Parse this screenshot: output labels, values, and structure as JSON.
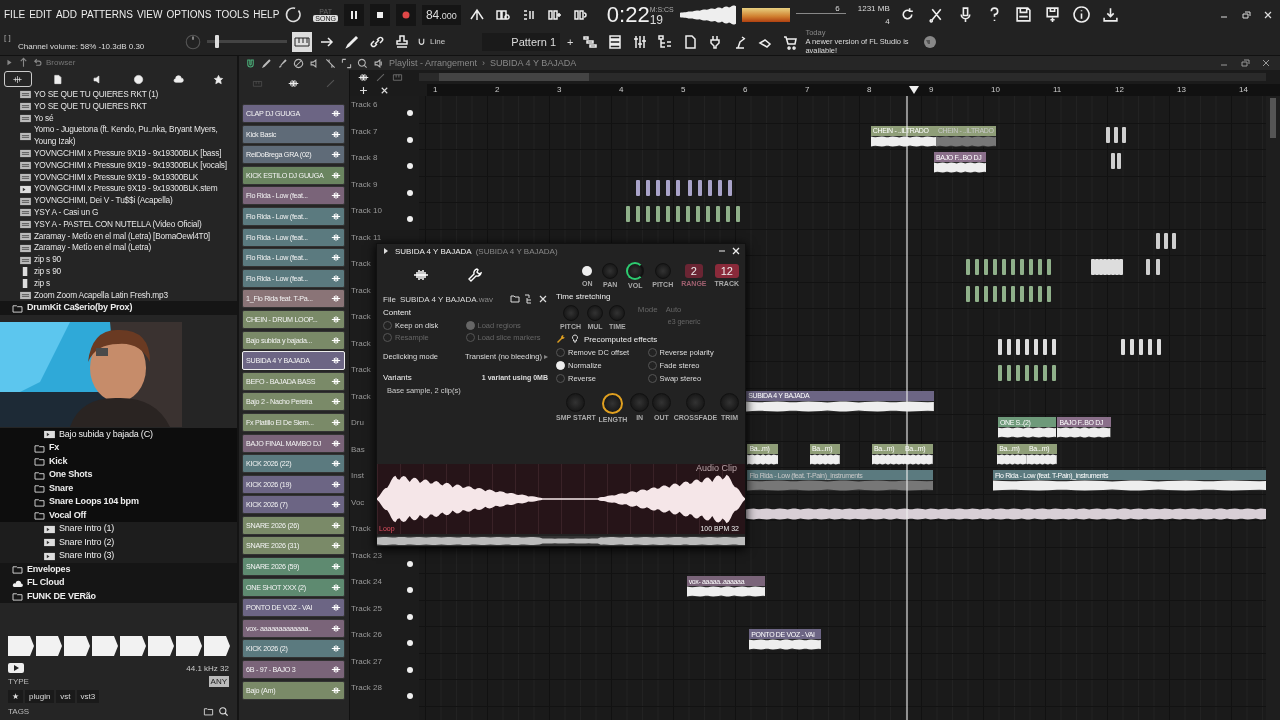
{
  "menu": [
    "FILE",
    "EDIT",
    "ADD",
    "PATTERNS",
    "VIEW",
    "OPTIONS",
    "TOOLS",
    "HELP"
  ],
  "transport": {
    "modes": [
      {
        "label": "PAT",
        "selected": false
      },
      {
        "label": "SONG",
        "selected": true
      }
    ],
    "tempo": "84",
    "tempo_decimals": ".000",
    "time": "0:22",
    "time_cs": "19",
    "time_unit": "M:S:CS"
  },
  "status": {
    "cpu": "6",
    "memory": "1231 MB",
    "polyphony": "4"
  },
  "hint_bar": {
    "brackets": "[ ]",
    "text": "Channel volume: 58%  -10.3dB  0.30"
  },
  "master_pitch": {
    "level": 0.12
  },
  "snap": {
    "mode": "Line"
  },
  "pattern": {
    "name": "Pattern 1",
    "add": "+"
  },
  "news": {
    "date": "Today",
    "text": "A newer version of FL Studio is available!"
  },
  "browser": {
    "title": "Browser",
    "tabs": [
      {
        "selected": true
      },
      {
        "selected": false
      },
      {
        "selected": false
      },
      {
        "selected": false
      },
      {
        "selected": false
      },
      {
        "selected": false
      }
    ],
    "files": [
      {
        "name": "YO SE QUE TU QUIERES RKT (1)",
        "kind": "mp3"
      },
      {
        "name": "YO SE QUE TU QUIERES RKT",
        "kind": "mp3"
      },
      {
        "name": "Yo sé",
        "kind": "mp3"
      },
      {
        "name": "Yomo - Juguetona (ft. Kendo, Pu..nka, Bryant Myers, Young Izak)",
        "kind": "mp3"
      },
      {
        "name": "YOVNGCHIMI x Pressure 9X19 - 9x19300BLK [bass]",
        "kind": "mp3"
      },
      {
        "name": "YOVNGCHIMI x Pressure 9X19 - 9x19300BLK [vocals]",
        "kind": "mp3"
      },
      {
        "name": "YOVNGCHIMI x Pressure 9X19 - 9x19300BLK",
        "kind": "mp3"
      },
      {
        "name": "YOVNGCHIMI x Pressure 9X19 - 9x19300BLK.stem",
        "kind": "stem"
      },
      {
        "name": "YOVNGCHIMI, Dei V - Tu$$i (Acapella)",
        "kind": "mp3"
      },
      {
        "name": "YSY A - Casi un G",
        "kind": "mp3"
      },
      {
        "name": "YSY A - PASTEL CON NUTELLA (Video Oficial)",
        "kind": "mp3"
      },
      {
        "name": "Zaramay - Metío en el mal (Letra) [BomaOewl4T0]",
        "kind": "mp3"
      },
      {
        "name": "Zaramay - Metío en el mal (Letra)",
        "kind": "mp3"
      },
      {
        "name": "zip s 90",
        "kind": "mp3"
      },
      {
        "name": "zip s 90",
        "kind": "zip"
      },
      {
        "name": "zip s",
        "kind": "zip"
      },
      {
        "name": "Zoom Zoom Acapella Latin Fresh.mp3",
        "kind": "mp3"
      }
    ],
    "tree": [
      {
        "name": "DrumKit Ca$erio(by Prox)",
        "kind": "folder",
        "children": [
          {
            "name": "Bajo subida y bajada (C)",
            "kind": "sample"
          },
          {
            "name": "Fx",
            "kind": "folder"
          },
          {
            "name": "Kick",
            "kind": "folder"
          },
          {
            "name": "One Shots",
            "kind": "folder"
          },
          {
            "name": "Snare",
            "kind": "folder"
          },
          {
            "name": "Snare Loops 104 bpm",
            "kind": "folder"
          },
          {
            "name": "Vocal Off",
            "kind": "folder"
          },
          {
            "name": "Snare Intro (1)",
            "kind": "sample"
          },
          {
            "name": "Snare Intro (2)",
            "kind": "sample"
          },
          {
            "name": "Snare Intro (3)",
            "kind": "sample"
          }
        ]
      },
      {
        "name": "Envelopes",
        "kind": "folder"
      },
      {
        "name": "FL Cloud",
        "kind": "cloud"
      },
      {
        "name": "FUNK DE VERão",
        "kind": "folder"
      }
    ],
    "sample_info": "44.1 kHz 32",
    "type_label": "TYPE",
    "type_value": "ANY",
    "tags": [
      "★",
      "plugin",
      "vst",
      "vst3"
    ],
    "tags_label": "TAGS"
  },
  "channels": [
    {
      "name": "CLAP DJ GUUGA",
      "color": "#6c6584",
      "selected": false
    },
    {
      "name": "Kick Basic",
      "color": "#5f6b78",
      "selected": false
    },
    {
      "name": "ReiDoBrega GRA (02)",
      "color": "#5f6b78",
      "selected": false
    },
    {
      "name": "KICK ESTILO DJ GUUGA",
      "color": "#6a8560",
      "selected": false
    },
    {
      "name": "Flo Rida - Low (feat...",
      "color": "#7a6479",
      "selected": false
    },
    {
      "name": "Flo Rida - Low (feat...",
      "color": "#5b7a7f",
      "selected": false
    },
    {
      "name": "Flo Rida - Low (feat...",
      "color": "#5b7a7f",
      "selected": false
    },
    {
      "name": "Flo Rida - Low (feat...",
      "color": "#5b7a7f",
      "selected": false
    },
    {
      "name": "Flo Rida - Low (feat...",
      "color": "#5b7a7f",
      "selected": false
    },
    {
      "name": "1_Flo Rida feat. T-Pa...",
      "color": "#8a7477",
      "selected": false
    },
    {
      "name": "CHEIN - DRUM LOOP...",
      "color": "#7a8a68",
      "selected": false
    },
    {
      "name": "Bajo subida y bajada...",
      "color": "#7a8a68",
      "selected": false
    },
    {
      "name": "SUBIDA 4 Y BAJADA",
      "color": "#6c6584",
      "selected": true
    },
    {
      "name": "BEFO - BAJADA BASS",
      "color": "#7a8a68",
      "selected": false
    },
    {
      "name": "Bajo 2 - Nacho Pereira",
      "color": "#7a8a68",
      "selected": false
    },
    {
      "name": "Fx Platillo El De Siem...",
      "color": "#7a8a68",
      "selected": false
    },
    {
      "name": "BAJO FINAL MAMBO DJ",
      "color": "#7a6479",
      "selected": false
    },
    {
      "name": "KICK 2026 (22)",
      "color": "#5b7a7f",
      "selected": false
    },
    {
      "name": "KICK 2026 (19)",
      "color": "#6c6584",
      "selected": false
    },
    {
      "name": "KICK 2026 (7)",
      "color": "#6c6584",
      "selected": false
    },
    {
      "name": "SNARE 2026 (26)",
      "color": "#7a8a68",
      "selected": false
    },
    {
      "name": "SNARE 2026 (31)",
      "color": "#7a8a68",
      "selected": false
    },
    {
      "name": "SNARE 2026 (59)",
      "color": "#5e8a70",
      "selected": false
    },
    {
      "name": "ONE SHOT XXX (2)",
      "color": "#5e8a70",
      "selected": false
    },
    {
      "name": "PONTO DE VOZ - VAI",
      "color": "#6c6584",
      "selected": false
    },
    {
      "name": "vox- aaaaaaaaaaaaa..",
      "color": "#7a6479",
      "selected": false
    },
    {
      "name": "KICK 2026 (2)",
      "color": "#5b7a7f",
      "selected": false
    },
    {
      "name": "6B - 97 - BAJO 3",
      "color": "#7a6479",
      "selected": false
    },
    {
      "name": "Bajo (Am)",
      "color": "#7a8a68",
      "selected": false
    }
  ],
  "playlist": {
    "title": "Playlist - Arrangement",
    "separator": "›",
    "pattern": "SUBIDA 4 Y BAJADA",
    "ruler": [
      "1",
      "2",
      "3",
      "4",
      "5",
      "6",
      "7",
      "8",
      "9",
      "10",
      "11",
      "12",
      "13",
      "14"
    ],
    "tracks": [
      {
        "label": "Track 6",
        "on": true
      },
      {
        "label": "Track 7",
        "on": true,
        "clips": [
          {
            "label": "CHEIN - ..ILTRADO",
            "color": "#8f9e78",
            "muted": false
          },
          {
            "label": "CHEIN - ..ILTRADO",
            "color": "#8f9e78",
            "muted": true
          }
        ]
      },
      {
        "label": "Track 8",
        "on": true,
        "clips": [
          {
            "label": "BAJO F...BO DJ",
            "color": "#8a6f8a",
            "muted": false
          }
        ]
      },
      {
        "label": "Track 9",
        "on": true
      },
      {
        "label": "Track 10",
        "on": true
      },
      {
        "label": "Track 11"
      },
      {
        "label": "Track"
      },
      {
        "label": "Track"
      },
      {
        "label": "Track"
      },
      {
        "label": "Track"
      },
      {
        "label": "Track"
      },
      {
        "label": "Track",
        "clips": [
          {
            "label": "SUBIDA 4 Y BAJADA",
            "color": "#6c6584",
            "muted": false
          }
        ]
      },
      {
        "label": "Dru",
        "clips": [
          {
            "label": "ONE S..(2)",
            "color": "#6e9a7a",
            "muted": false
          },
          {
            "label": "BAJO F..BO DJ",
            "color": "#8a6f8a",
            "muted": false
          }
        ]
      },
      {
        "label": "Bas",
        "clips": [
          {
            "label": "Ba...m)",
            "color": "#8f9e78",
            "muted": false
          },
          {
            "label": "Ba...m)",
            "color": "#8f9e78",
            "muted": false
          },
          {
            "label": "Ba...m)",
            "color": "#8f9e78",
            "muted": false
          },
          {
            "label": "Ba...m)",
            "color": "#8f9e78",
            "muted": false
          },
          {
            "label": "Ba...m)",
            "color": "#8f9e78",
            "muted": false
          },
          {
            "label": "Ba...m)",
            "color": "#8f9e78",
            "muted": false
          }
        ]
      },
      {
        "label": "Inst",
        "clips": [
          {
            "label": "Flo Rida - Low (feat. T-Pain)_instruments",
            "color": "#5b7a7f",
            "muted": true
          },
          {
            "label": "Flo Rida - Low (feat. T-Pain)_instruments",
            "color": "#5b7a7f",
            "muted": false
          }
        ]
      },
      {
        "label": "Voc"
      },
      {
        "label": "Track"
      },
      {
        "label": "Track 23",
        "on": true
      },
      {
        "label": "Track 24",
        "on": true,
        "clips": [
          {
            "label": "vox- aaaaa..aaaaaa",
            "color": "#7a6479",
            "muted": false
          }
        ]
      },
      {
        "label": "Track 25",
        "on": true
      },
      {
        "label": "Track 26",
        "on": true,
        "clips": [
          {
            "label": "PONTO DE VOZ - VAI",
            "color": "#6c6584",
            "muted": false
          }
        ]
      },
      {
        "label": "Track 27",
        "on": true
      },
      {
        "label": "Track 28",
        "on": true
      }
    ]
  },
  "sampler": {
    "title": "SUBIDA 4 Y BAJADA",
    "subtitle": "(SUBIDA 4 Y BAJADA)",
    "top_controls": [
      {
        "label": "ON",
        "kind": "led"
      },
      {
        "label": "PAN",
        "kind": "knob"
      },
      {
        "label": "VOL",
        "kind": "accent"
      },
      {
        "label": "PITCH",
        "kind": "knob"
      }
    ],
    "range_label": "RANGE",
    "range": "2",
    "track_label": "TRACK",
    "track": "12",
    "file_label": "File",
    "file_name": "SUBIDA 4 Y BAJADA",
    "file_ext": ".wav",
    "content_label": "Content",
    "content_options": [
      {
        "label": "Keep on disk",
        "checked": false,
        "disabled": false
      },
      {
        "label": "Load regions",
        "checked": true,
        "disabled": true
      },
      {
        "label": "Resample",
        "checked": false,
        "disabled": true
      },
      {
        "label": "Load slice markers",
        "checked": false,
        "disabled": true
      }
    ],
    "declick_label": "Declicking mode",
    "declick_value": "Transient (no bleeding)",
    "declick_arrow": "▸",
    "variants_label": "Variants",
    "variants_info": "1 variant using 0MB",
    "variants_value": "Base sample, 2 clip(s)",
    "stretch_title": "Time stretching",
    "stretch_knobs": [
      "PITCH",
      "MUL",
      "TIME"
    ],
    "mode_label": "Mode",
    "mode_value": "Auto",
    "mode_detail": "e3 generic",
    "effects_title": "Precomputed effects",
    "effects": [
      {
        "label": "Remove DC offset",
        "checked": false
      },
      {
        "label": "Reverse polarity",
        "checked": false
      },
      {
        "label": "Normalize",
        "checked": true
      },
      {
        "label": "Fade stereo",
        "checked": false
      },
      {
        "label": "Reverse",
        "checked": false
      },
      {
        "label": "Swap stereo",
        "checked": false
      }
    ],
    "envelope_knobs": [
      {
        "label": "SMP START",
        "selected": false
      },
      {
        "label": "LENGTH",
        "selected": true
      },
      {
        "label": "IN",
        "selected": false
      },
      {
        "label": "OUT",
        "selected": false
      },
      {
        "label": "CROSSFADE",
        "selected": false
      },
      {
        "label": "TRIM",
        "selected": false
      }
    ],
    "wave_title": "Audio Clip",
    "loop": "Loop",
    "wave_tempo": "100 BPM",
    "wave_bits": "32"
  }
}
